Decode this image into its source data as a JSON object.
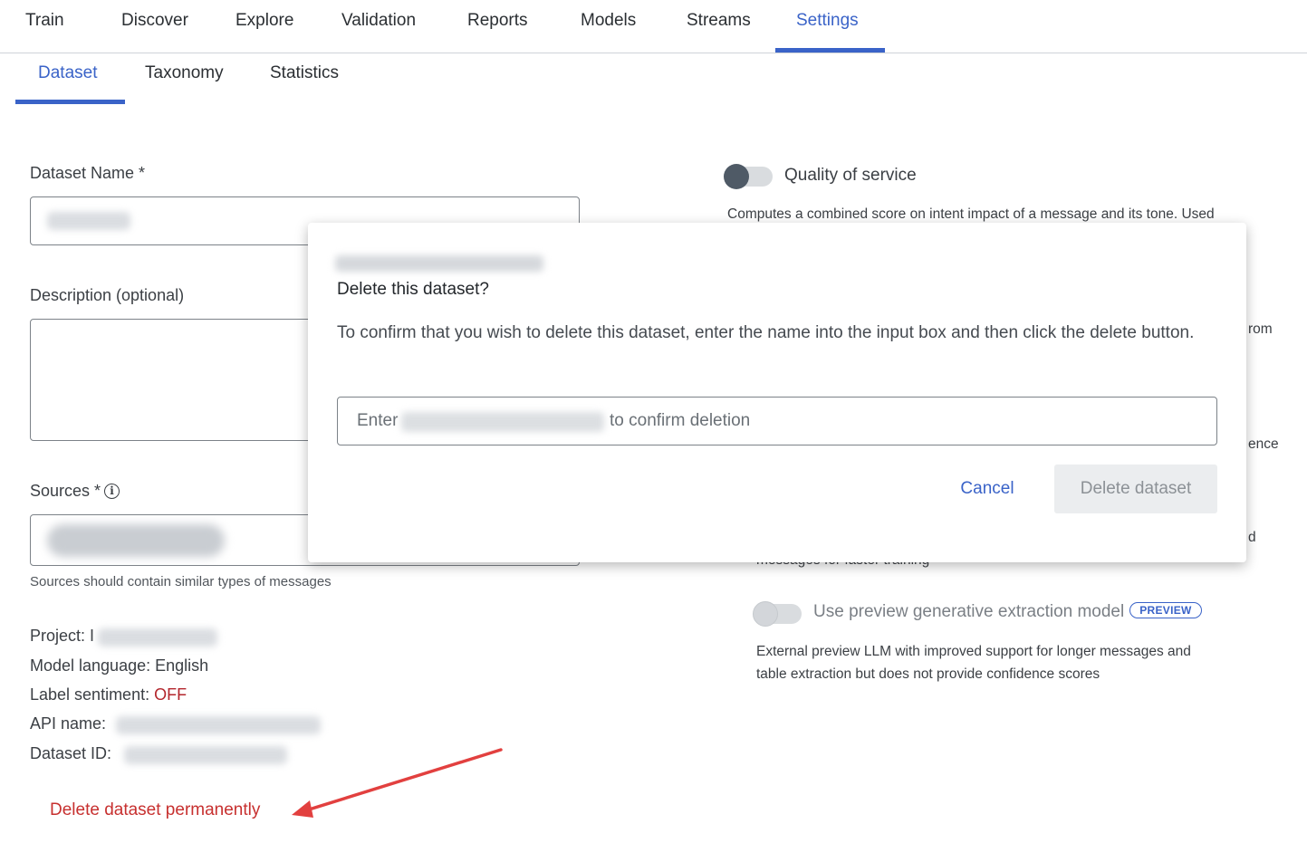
{
  "top_nav": {
    "tabs": [
      "Train",
      "Discover",
      "Explore",
      "Validation",
      "Reports",
      "Models",
      "Streams",
      "Settings"
    ],
    "active": "Settings"
  },
  "sub_nav": {
    "tabs": [
      "Dataset",
      "Taxonomy",
      "Statistics"
    ],
    "active": "Dataset"
  },
  "form": {
    "dataset_name_label": "Dataset Name *",
    "description_label": "Description (optional)",
    "sources_label": "Sources *",
    "sources_help": "Sources should contain similar types of messages"
  },
  "meta": {
    "project_label": "Project:",
    "project_prefix": "I",
    "model_language_label": "Model language:",
    "model_language_value": "English",
    "label_sentiment_label": "Label sentiment:",
    "label_sentiment_value": "OFF",
    "api_name_label": "API name:",
    "dataset_id_label": "Dataset ID:"
  },
  "delete_link": "Delete dataset permanently",
  "right_panel": {
    "quality_label": "Quality of service",
    "quality_desc": "Computes a combined score on intent impact of a message and its tone. Used",
    "partial_1": "rom",
    "partial_2": "ence",
    "partial_3": "d",
    "partial_4": "messages for faster training",
    "preview_label": "Use preview generative extraction model",
    "preview_badge": "PREVIEW",
    "preview_desc_1": "External preview LLM with improved support for longer messages and",
    "preview_desc_2": "table extraction but does not provide confidence scores"
  },
  "modal": {
    "title": "Delete this dataset?",
    "body": "To confirm that you wish to delete this dataset, enter the name into the input box and then click the delete button.",
    "placeholder_prefix": "Enter",
    "placeholder_suffix": "to confirm deletion",
    "cancel_label": "Cancel",
    "delete_label": "Delete dataset"
  },
  "colors": {
    "accent": "#3a63c8",
    "danger": "#c7302f",
    "annotation_arrow": "#e2403f"
  }
}
